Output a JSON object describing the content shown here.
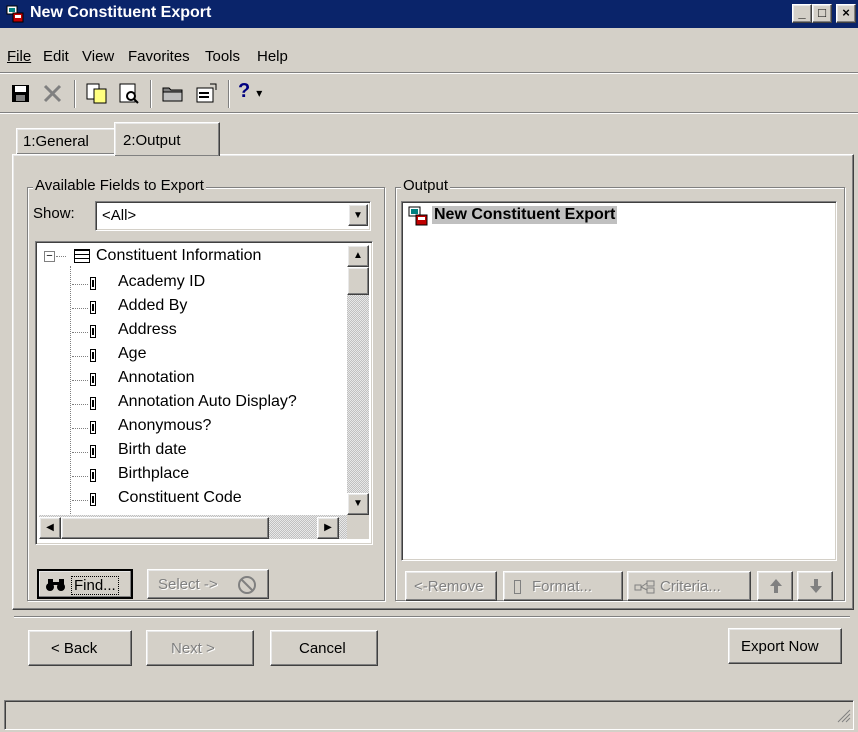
{
  "window": {
    "title": "New Constituent Export",
    "minimize": "_",
    "maximize": "□",
    "close": "×"
  },
  "menu": [
    {
      "label": "File"
    },
    {
      "label": "Edit"
    },
    {
      "label": "View"
    },
    {
      "label": "Favorites"
    },
    {
      "label": "Tools"
    },
    {
      "label": "Help"
    }
  ],
  "toolbar": {
    "icons": [
      "save-icon",
      "delete-icon",
      "copy-icon",
      "preview-icon",
      "folder-icon",
      "properties-icon",
      "help-icon"
    ],
    "help_glyph": "?",
    "dropdown_glyph": "▾"
  },
  "tabs": [
    {
      "label": "1:General",
      "active": false
    },
    {
      "label": "2:Output",
      "active": true
    }
  ],
  "available": {
    "group_label": "Available Fields to Export",
    "show_label": "Show:",
    "show_value": "<All>",
    "tree_root": "Constituent Information",
    "fields": [
      "Academy ID",
      "Added By",
      "Address",
      "Age",
      "Annotation",
      "Annotation Auto Display?",
      "Anonymous?",
      "Birth date",
      "Birthplace",
      "Constituent Code"
    ],
    "find_button": "Find...",
    "select_button": "Select ->"
  },
  "output": {
    "group_label": "Output",
    "root_item": "New Constituent Export",
    "remove_button": "<-Remove",
    "format_button": "Format...",
    "criteria_button": "Criteria...",
    "up_glyph": "🡑",
    "down_glyph": "🡓"
  },
  "footer": {
    "back_button": "< Back",
    "next_button": "Next >",
    "cancel_button": "Cancel",
    "export_button": "Export Now"
  },
  "colors": {
    "titlebar": "#0a246a",
    "face": "#d4d0c8",
    "selection": "#c0c0c0"
  }
}
